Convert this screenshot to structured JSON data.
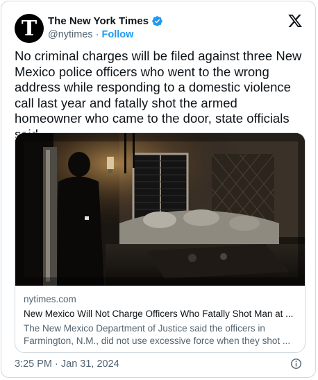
{
  "author": {
    "name": "The New York Times",
    "handle": "@nytimes",
    "separator": "·",
    "follow_label": "Follow",
    "avatar_glyph": "T",
    "avatar_icon": "nyt-logo-icon",
    "verified_icon": "verified-badge-icon",
    "verified_color": "#1d9bf0"
  },
  "platform_icon": "x-logo-icon",
  "tweet": {
    "text": "No criminal charges will be filed against three New Mexico police officers who went to the wrong address while responding to a domestic violence call last year and fatally shot the armed homeowner who came to the door, state officials said."
  },
  "link_card": {
    "domain": "nytimes.com",
    "title": "New Mexico Will Not Charge Officers Who Fatally Shot Man at ...",
    "description": "The New Mexico Department of Justice said the officers in Farmington, N.M., did not use excessive force when they shot ...",
    "media_description_icon": "bodycam-photo"
  },
  "footer": {
    "timestamp": "3:25 PM · Jan 31, 2024",
    "info_icon": "info-icon"
  },
  "colors": {
    "link_blue": "#1d9bf0",
    "secondary_text": "#536471",
    "primary_text": "#0f1419",
    "border": "#cfd9de"
  }
}
